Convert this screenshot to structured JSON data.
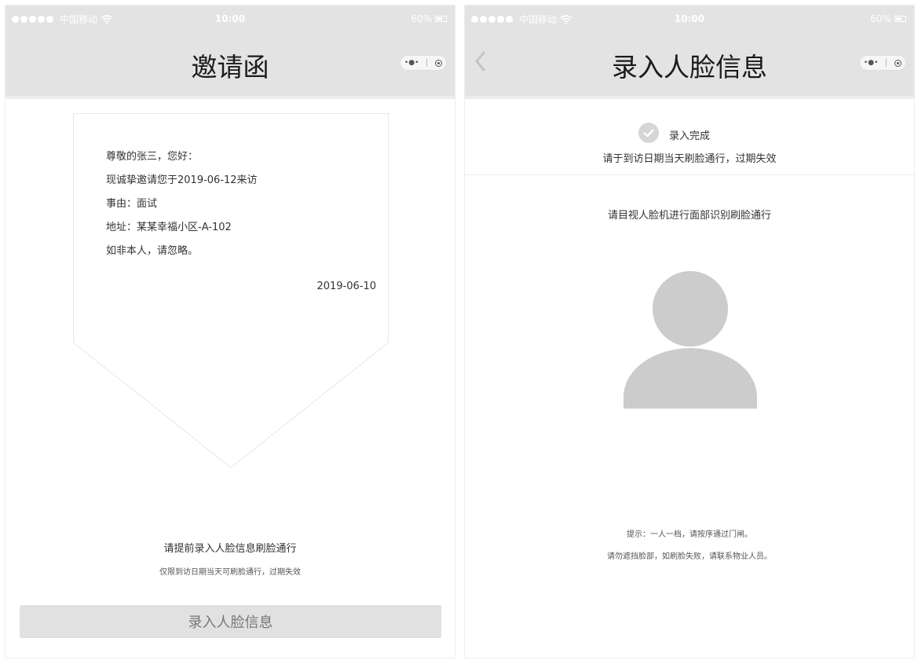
{
  "status_bar": {
    "carrier": "中国移动",
    "time": "10:00",
    "battery": "60%"
  },
  "invitation_screen": {
    "title": "邀请函",
    "letter": {
      "greeting": "尊敬的张三，您好：",
      "invite_line": "现诚挚邀请您于2019-06-12来访",
      "reason": "事由：面试",
      "address": "地址：某某幸福小区-A-102",
      "ignore_note": "如非本人，请忽略。",
      "date": "2019-06-10"
    },
    "hint_main": "请提前录入人脸信息刷脸通行",
    "hint_sub": "仅限到访日期当天可刷脸通行，过期失效",
    "enroll_button": "录入人脸信息"
  },
  "face_screen": {
    "title": "录入人脸信息",
    "done_label": "录入完成",
    "valid_note": "请于到访日期当天刷脸通行，过期失效",
    "instruction": "请目视人脸机进行面部识别刷脸通行",
    "tip_1": "提示：一人一档，请按序通过门闸。",
    "tip_2": "请勿遮挡脸部，如刷脸失败，请联系物业人员。"
  },
  "icons": {
    "back": "chevron-left-icon",
    "menu": "more-dots-icon",
    "close": "target-circle-icon",
    "check": "checkmark-icon",
    "avatar": "user-silhouette-icon",
    "wifi": "wifi-icon",
    "battery": "battery-icon"
  },
  "colors": {
    "nav_bar": "#e3e3e3",
    "button_bg": "#e1e1e1",
    "check_bg": "#d6d6d6",
    "avatar": "#cccccc"
  }
}
